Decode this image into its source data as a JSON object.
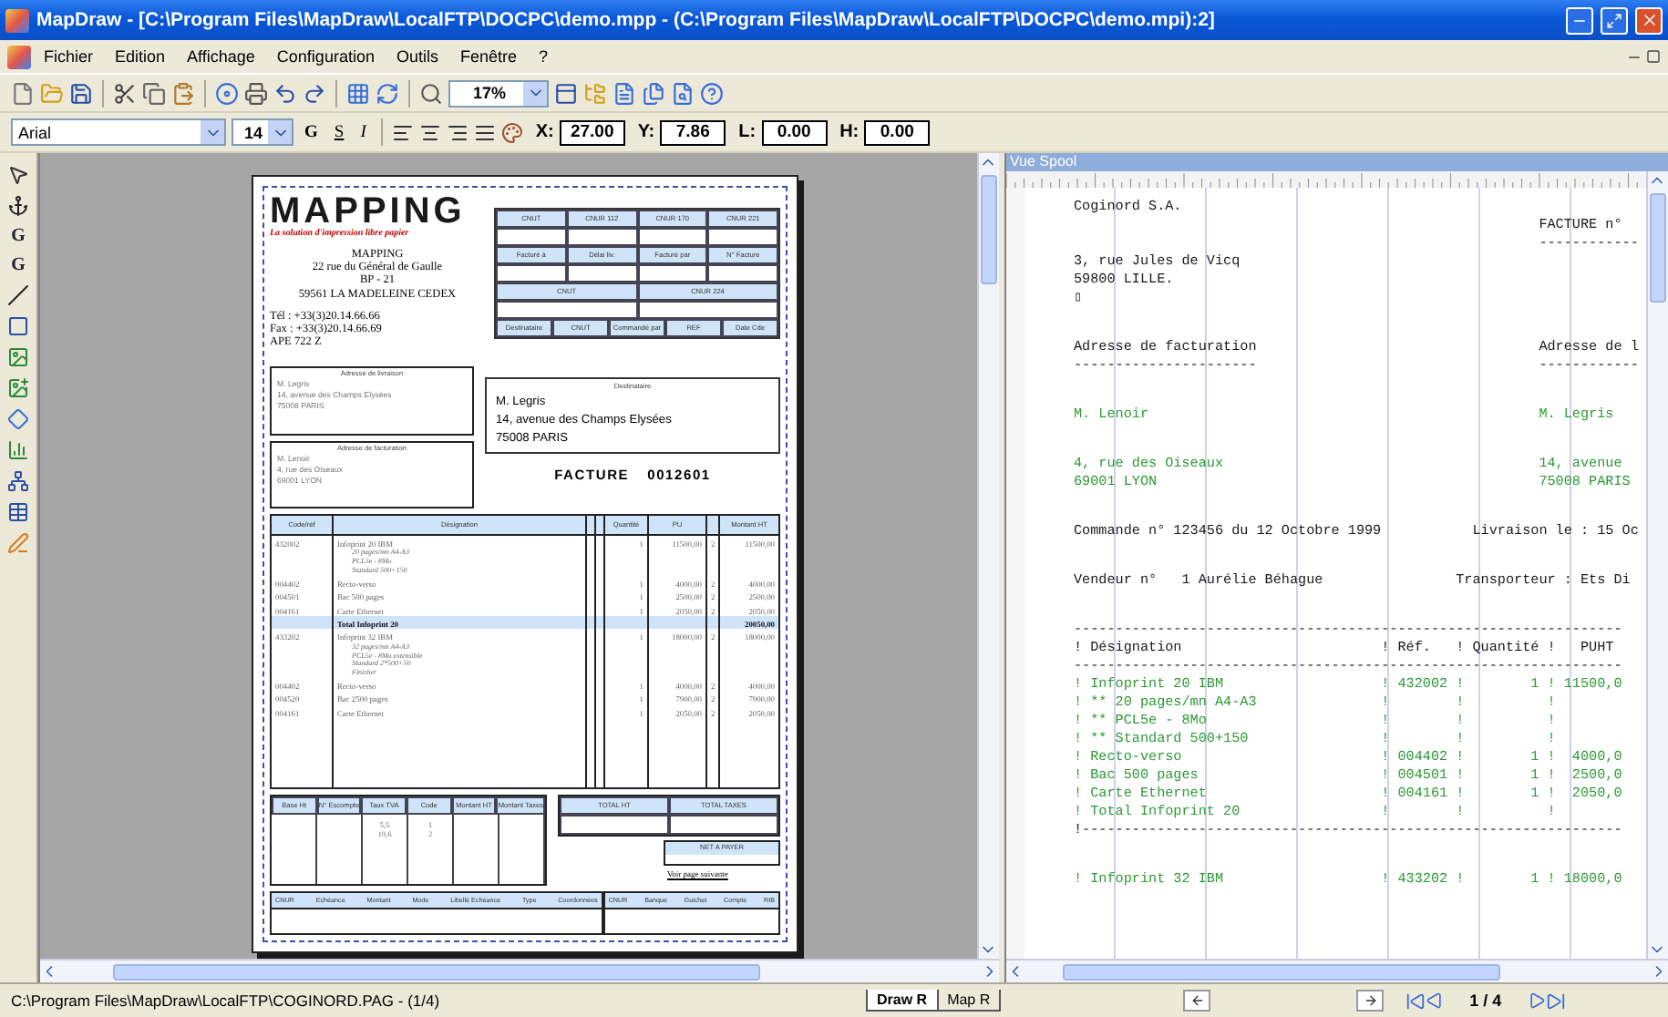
{
  "window": {
    "title": "MapDraw - [C:\\Program Files\\MapDraw\\LocalFTP\\DOCPC\\demo.mpp - (C:\\Program Files\\MapDraw\\LocalFTP\\DOCPC\\demo.mpi):2]"
  },
  "menu": [
    "Fichier",
    "Edition",
    "Affichage",
    "Configuration",
    "Outils",
    "Fenêtre",
    "?"
  ],
  "toolbar": {
    "zoom": "17%"
  },
  "format_bar": {
    "font": "Arial",
    "size": "14",
    "styles": [
      "G",
      "S",
      "I"
    ],
    "fields": [
      {
        "label": "X:",
        "value": "27.00"
      },
      {
        "label": "Y:",
        "value": "7.86"
      },
      {
        "label": "L:",
        "value": "0.00"
      },
      {
        "label": "H:",
        "value": "0.00"
      }
    ]
  },
  "side_tools": [
    "G",
    "G"
  ],
  "document": {
    "company": {
      "logo": "MAPPING",
      "tagline": "La solution d'impression libre papier",
      "address": [
        "MAPPING",
        "22 rue du Général de Gaulle",
        "BP - 21",
        "59561 LA MADELEINE CEDEX"
      ],
      "contact": [
        "Tél : +33(3)20.14.66.66",
        "Fax : +33(3)20.14.66.69",
        "APE 722 Z"
      ]
    },
    "header_grid": [
      {
        "cells": [
          "CNUT",
          "CNUR 112",
          "CNUR 170",
          "CNUR 221"
        ]
      },
      {
        "cells": [
          "Facturé à",
          "Délai liv.",
          "Facturé par",
          "N° Facture"
        ]
      },
      {
        "cells": [
          "CNUT",
          "CNUR 224"
        ]
      },
      {
        "cells": [
          "Destinataire",
          "CNUT",
          "Commandé par",
          "REF",
          "Date Cde"
        ]
      }
    ],
    "address_boxes": [
      {
        "title": "Adresse de livraison",
        "lines": [
          "M. Legris",
          "14, avenue des Champs Elysées",
          "75008 PARIS"
        ]
      },
      {
        "title": "Adresse de facturation",
        "lines": [
          "M. Lenoir",
          "4, rue des Oiseaux",
          "69001 LYON"
        ]
      }
    ],
    "recipient": {
      "title": "Destinataire",
      "lines": [
        "M. Legris",
        "14, avenue des Champs Elysées",
        "75008 PARIS"
      ]
    },
    "invoice": {
      "label": "FACTURE",
      "number": "0012601"
    },
    "items": {
      "columns": [
        "Code/réf",
        "Désignation",
        "Quantité",
        "PU",
        "Montant HT"
      ],
      "rows": [
        {
          "kind": "item",
          "code": "432002",
          "name": "Infoprint 20 IBM",
          "details": [
            "20 pages/mn A4-A3",
            "PCL5e - 8Mo",
            "Standard 500+150"
          ],
          "qty": "1",
          "pu": "11500,00",
          "tva": "2",
          "amount": "11500,00"
        },
        {
          "kind": "item",
          "code": "004402",
          "name": "Recto-verso",
          "qty": "1",
          "pu": "4000,00",
          "tva": "2",
          "amount": "4000,00"
        },
        {
          "kind": "item",
          "code": "004501",
          "name": "Bac 500 pages",
          "qty": "1",
          "pu": "2500,00",
          "tva": "2",
          "amount": "2500,00"
        },
        {
          "kind": "item",
          "code": "004161",
          "name": "Carte Ethernet",
          "qty": "1",
          "pu": "2050,00",
          "tva": "2",
          "amount": "2050,00"
        },
        {
          "kind": "total",
          "name": "Total Infoprint 20",
          "amount": "20050,00"
        },
        {
          "kind": "item",
          "code": "433202",
          "name": "Infoprint 32 IBM",
          "details": [
            "32 pages/mn A4-A3",
            "PCL5e - 8Mo extensible",
            "Standard 2*500+50",
            "Finisher"
          ],
          "qty": "1",
          "pu": "18000,00",
          "tva": "2",
          "amount": "18000,00"
        },
        {
          "kind": "item",
          "code": "004402",
          "name": "Recto-verso",
          "qty": "1",
          "pu": "4000,00",
          "tva": "2",
          "amount": "4000,00"
        },
        {
          "kind": "item",
          "code": "004520",
          "name": "Bac 2500 pages",
          "qty": "1",
          "pu": "7900,00",
          "tva": "2",
          "amount": "7900,00"
        },
        {
          "kind": "item",
          "code": "004161",
          "name": "Carte Ethernet",
          "qty": "1",
          "pu": "2050,00",
          "tva": "2",
          "amount": "2050,00"
        }
      ]
    },
    "tax": {
      "columns": [
        "Base Ht",
        "N° Escompte",
        "Taux TVA",
        "Code",
        "Montant HT",
        "Montant Taxes"
      ],
      "rates": [
        "5,5",
        "19,6"
      ],
      "codes": [
        "1",
        "2"
      ]
    },
    "totals": {
      "columns": [
        "TOTAL HT",
        "TOTAL TAXES"
      ],
      "net": "NET A PAYER",
      "note": "Voir page suivante"
    },
    "bank": {
      "left": [
        "CNUR",
        "Echéance",
        "Montant",
        "Mode",
        "Libellé Echéance",
        "Type",
        "Coordonnées"
      ],
      "right": [
        "CNUR",
        "Banque",
        "Guichet",
        "Compte",
        "RIB"
      ]
    }
  },
  "spool": {
    "title": "Vue Spool",
    "blocks": [
      {
        "lines": [
          {
            "kind": "plain",
            "text": "Coginord S.A."
          },
          {
            "kind": "plain",
            "text": "                                                        FACTURE n°"
          },
          {
            "kind": "plain",
            "text": "                                                        ------------"
          },
          {
            "kind": "plain",
            "text": "3, rue Jules de Vicq"
          },
          {
            "kind": "plain",
            "text": "59800 LILLE."
          },
          {
            "kind": "plain",
            "text": "▯"
          }
        ]
      },
      {
        "lines": [
          {
            "kind": "plain",
            "text": "Adresse de facturation                                  Adresse de l"
          },
          {
            "kind": "plain",
            "text": "----------------------                                  ------------"
          }
        ]
      },
      {
        "lines": [
          {
            "kind": "data",
            "text": "M. Lenoir                                               M. Legris"
          }
        ]
      },
      {
        "lines": [
          {
            "kind": "data",
            "text": "4, rue des Oiseaux                                      14, avenue"
          },
          {
            "kind": "data",
            "text": "69001 LYON                                              75008 PARIS"
          }
        ]
      },
      {
        "lines": [
          {
            "kind": "plain",
            "text": "Commande n° 123456 du 12 Octobre 1999           Livraison le : 15 Oc"
          }
        ]
      },
      {
        "lines": [
          {
            "kind": "plain",
            "text": "Vendeur n°   1 Aurélie Béhague                Transporteur : Ets Di"
          }
        ]
      },
      {
        "lines": [
          {
            "kind": "plain",
            "text": "------------------------------------------------------------------"
          },
          {
            "kind": "plain",
            "text": "! Désignation                        ! Réf.   ! Quantité !   PUHT"
          },
          {
            "kind": "plain",
            "text": "------------------------------------------------------------------"
          },
          {
            "kind": "data",
            "text": "! Infoprint 20 IBM                   ! 432002 !        1 ! 11500,0"
          },
          {
            "kind": "data",
            "text": "! ** 20 pages/mn A4-A3               !        !          !"
          },
          {
            "kind": "data",
            "text": "! ** PCL5e - 8Mo                     !        !          !"
          },
          {
            "kind": "data",
            "text": "! ** Standard 500+150                !        !          !"
          },
          {
            "kind": "data",
            "text": "! Recto-verso                        ! 004402 !        1 !  4000,0"
          },
          {
            "kind": "data",
            "text": "! Bac 500 pages                      ! 004501 !        1 !  2500,0"
          },
          {
            "kind": "data",
            "text": "! Carte Ethernet                     ! 004161 !        1 !  2050,0"
          },
          {
            "kind": "data",
            "text": "! Total Infoprint 20                 !        !          !"
          },
          {
            "kind": "plain",
            "text": "!-----------------------------------------------------------------"
          }
        ]
      },
      {
        "lines": [
          {
            "kind": "data",
            "text": "! Infoprint 32 IBM                   ! 433202 !        1 ! 18000,0"
          }
        ]
      }
    ]
  },
  "status_bar": {
    "path": "C:\\Program Files\\MapDraw\\LocalFTP\\COGINORD.PAG - (1/4)",
    "tabs": [
      {
        "label": "Draw R",
        "selected": true
      },
      {
        "label": "Map R",
        "selected": false
      }
    ],
    "page": "1 / 4"
  }
}
